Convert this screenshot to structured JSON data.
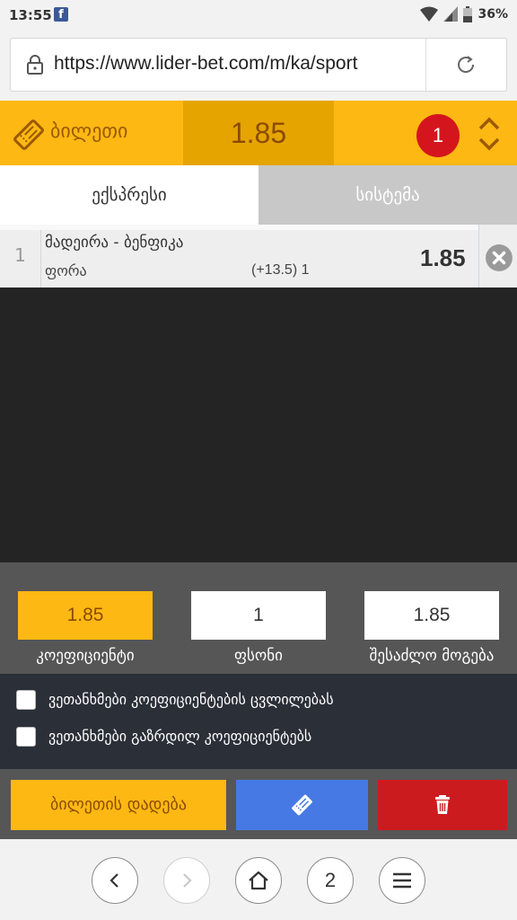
{
  "status_bar": {
    "time": "13:55",
    "battery": "36%",
    "icons": [
      "facebook-icon",
      "wifi-icon",
      "signal-icon",
      "battery-icon"
    ]
  },
  "browser": {
    "url": "https://www.lider-bet.com/m/ka/sport",
    "nav": {
      "tabs_count": "2"
    }
  },
  "ticket": {
    "title": "ბილეთი",
    "total_odds": "1.85",
    "count": "1",
    "tabs": [
      {
        "label": "ექსპრესი",
        "active": true
      },
      {
        "label": "სისტემა",
        "active": false
      }
    ],
    "bets": [
      {
        "index": "1",
        "match": "მადეირა - ბენფიკა",
        "market": "ფორა",
        "outcome": "(+13.5) 1",
        "odd": "1.85"
      }
    ]
  },
  "stake_panel": {
    "odds": {
      "value": "1.85",
      "label": "კოეფიციენტი"
    },
    "stake": {
      "value": "1",
      "label": "ფსონი"
    },
    "possible_win": {
      "value": "1.85",
      "label": "შესაძლო მოგება"
    }
  },
  "options": {
    "accept_odds_change": "ვეთანხმები კოეფიციენტების ცვლილებას",
    "accept_increased_odds": "ვეთანხმები გაზრდილ კოეფიციენტებს"
  },
  "actions": {
    "place_bet": "ბილეთის დადება"
  },
  "colors": {
    "accent": "#fdb813",
    "accent_dark": "#e5a400",
    "ticket_button": "#4679e4",
    "delete_button": "#cc1b1f",
    "badge": "#d5151d"
  }
}
